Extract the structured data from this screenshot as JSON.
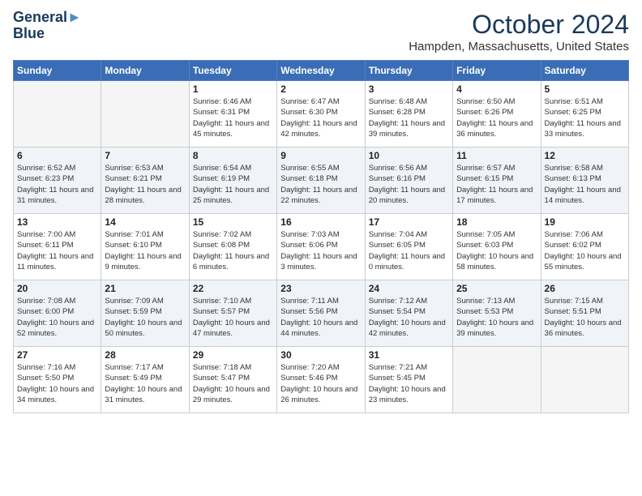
{
  "header": {
    "logo_line1": "General",
    "logo_line2": "Blue",
    "month": "October 2024",
    "location": "Hampden, Massachusetts, United States"
  },
  "weekdays": [
    "Sunday",
    "Monday",
    "Tuesday",
    "Wednesday",
    "Thursday",
    "Friday",
    "Saturday"
  ],
  "weeks": [
    [
      {
        "day": "",
        "info": ""
      },
      {
        "day": "",
        "info": ""
      },
      {
        "day": "1",
        "info": "Sunrise: 6:46 AM\nSunset: 6:31 PM\nDaylight: 11 hours and 45 minutes."
      },
      {
        "day": "2",
        "info": "Sunrise: 6:47 AM\nSunset: 6:30 PM\nDaylight: 11 hours and 42 minutes."
      },
      {
        "day": "3",
        "info": "Sunrise: 6:48 AM\nSunset: 6:28 PM\nDaylight: 11 hours and 39 minutes."
      },
      {
        "day": "4",
        "info": "Sunrise: 6:50 AM\nSunset: 6:26 PM\nDaylight: 11 hours and 36 minutes."
      },
      {
        "day": "5",
        "info": "Sunrise: 6:51 AM\nSunset: 6:25 PM\nDaylight: 11 hours and 33 minutes."
      }
    ],
    [
      {
        "day": "6",
        "info": "Sunrise: 6:52 AM\nSunset: 6:23 PM\nDaylight: 11 hours and 31 minutes."
      },
      {
        "day": "7",
        "info": "Sunrise: 6:53 AM\nSunset: 6:21 PM\nDaylight: 11 hours and 28 minutes."
      },
      {
        "day": "8",
        "info": "Sunrise: 6:54 AM\nSunset: 6:19 PM\nDaylight: 11 hours and 25 minutes."
      },
      {
        "day": "9",
        "info": "Sunrise: 6:55 AM\nSunset: 6:18 PM\nDaylight: 11 hours and 22 minutes."
      },
      {
        "day": "10",
        "info": "Sunrise: 6:56 AM\nSunset: 6:16 PM\nDaylight: 11 hours and 20 minutes."
      },
      {
        "day": "11",
        "info": "Sunrise: 6:57 AM\nSunset: 6:15 PM\nDaylight: 11 hours and 17 minutes."
      },
      {
        "day": "12",
        "info": "Sunrise: 6:58 AM\nSunset: 6:13 PM\nDaylight: 11 hours and 14 minutes."
      }
    ],
    [
      {
        "day": "13",
        "info": "Sunrise: 7:00 AM\nSunset: 6:11 PM\nDaylight: 11 hours and 11 minutes."
      },
      {
        "day": "14",
        "info": "Sunrise: 7:01 AM\nSunset: 6:10 PM\nDaylight: 11 hours and 9 minutes."
      },
      {
        "day": "15",
        "info": "Sunrise: 7:02 AM\nSunset: 6:08 PM\nDaylight: 11 hours and 6 minutes."
      },
      {
        "day": "16",
        "info": "Sunrise: 7:03 AM\nSunset: 6:06 PM\nDaylight: 11 hours and 3 minutes."
      },
      {
        "day": "17",
        "info": "Sunrise: 7:04 AM\nSunset: 6:05 PM\nDaylight: 11 hours and 0 minutes."
      },
      {
        "day": "18",
        "info": "Sunrise: 7:05 AM\nSunset: 6:03 PM\nDaylight: 10 hours and 58 minutes."
      },
      {
        "day": "19",
        "info": "Sunrise: 7:06 AM\nSunset: 6:02 PM\nDaylight: 10 hours and 55 minutes."
      }
    ],
    [
      {
        "day": "20",
        "info": "Sunrise: 7:08 AM\nSunset: 6:00 PM\nDaylight: 10 hours and 52 minutes."
      },
      {
        "day": "21",
        "info": "Sunrise: 7:09 AM\nSunset: 5:59 PM\nDaylight: 10 hours and 50 minutes."
      },
      {
        "day": "22",
        "info": "Sunrise: 7:10 AM\nSunset: 5:57 PM\nDaylight: 10 hours and 47 minutes."
      },
      {
        "day": "23",
        "info": "Sunrise: 7:11 AM\nSunset: 5:56 PM\nDaylight: 10 hours and 44 minutes."
      },
      {
        "day": "24",
        "info": "Sunrise: 7:12 AM\nSunset: 5:54 PM\nDaylight: 10 hours and 42 minutes."
      },
      {
        "day": "25",
        "info": "Sunrise: 7:13 AM\nSunset: 5:53 PM\nDaylight: 10 hours and 39 minutes."
      },
      {
        "day": "26",
        "info": "Sunrise: 7:15 AM\nSunset: 5:51 PM\nDaylight: 10 hours and 36 minutes."
      }
    ],
    [
      {
        "day": "27",
        "info": "Sunrise: 7:16 AM\nSunset: 5:50 PM\nDaylight: 10 hours and 34 minutes."
      },
      {
        "day": "28",
        "info": "Sunrise: 7:17 AM\nSunset: 5:49 PM\nDaylight: 10 hours and 31 minutes."
      },
      {
        "day": "29",
        "info": "Sunrise: 7:18 AM\nSunset: 5:47 PM\nDaylight: 10 hours and 29 minutes."
      },
      {
        "day": "30",
        "info": "Sunrise: 7:20 AM\nSunset: 5:46 PM\nDaylight: 10 hours and 26 minutes."
      },
      {
        "day": "31",
        "info": "Sunrise: 7:21 AM\nSunset: 5:45 PM\nDaylight: 10 hours and 23 minutes."
      },
      {
        "day": "",
        "info": ""
      },
      {
        "day": "",
        "info": ""
      }
    ]
  ]
}
